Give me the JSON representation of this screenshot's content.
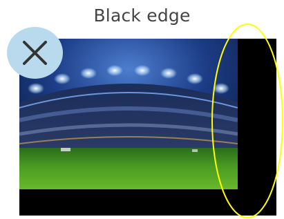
{
  "title": "Black edge",
  "badge_icon": "close-icon",
  "colors": {
    "badge": "#b9d9ec",
    "icon": "#333333",
    "highlight": "#ffff00",
    "edge": "#000000"
  }
}
